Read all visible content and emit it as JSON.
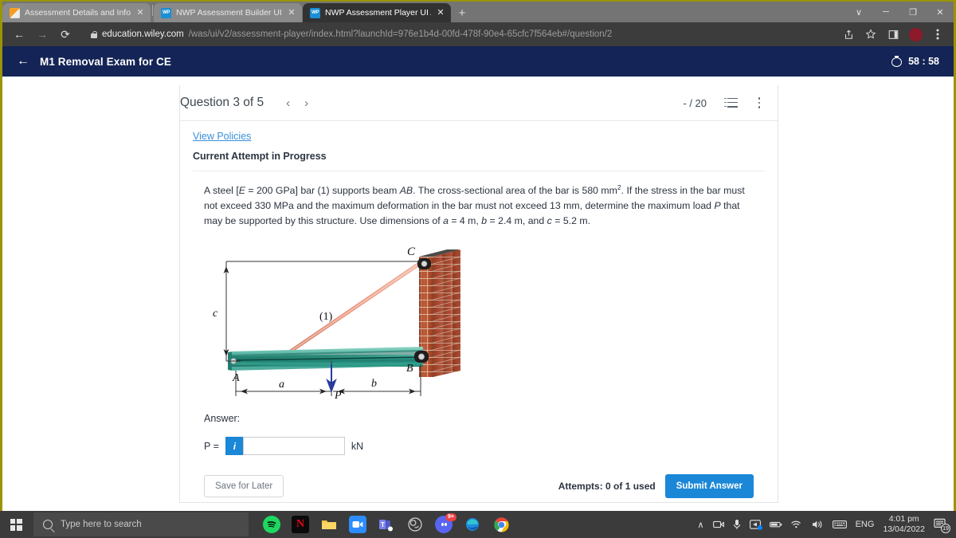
{
  "browser": {
    "tabs": [
      {
        "title": "Assessment Details and Informat",
        "favicon": "pencil-icon",
        "active": false
      },
      {
        "title": "NWP Assessment Builder UI App",
        "favicon": "wp-icon",
        "active": false
      },
      {
        "title": "NWP Assessment Player UI Appli",
        "favicon": "wp-icon",
        "active": true
      }
    ],
    "new_tab_label": "+",
    "close_label": "✕",
    "window_controls": {
      "minimize_all": "∨",
      "minimize": "─",
      "maximize": "❐",
      "close": "✕"
    },
    "nav": {
      "back": "←",
      "forward": "→",
      "reload": "⟳"
    },
    "url_host": "education.wiley.com",
    "url_path": "/was/ui/v2/assessment-player/index.html?launchId=976e1b4d-00fd-478f-90e4-65cfc7f564eb#/question/2",
    "toolbar_icons": [
      "share-icon",
      "bookmark-star-icon",
      "sidepanel-icon",
      "profile-avatar",
      "chrome-menu-icon"
    ]
  },
  "appbar": {
    "back_label": "←",
    "exam_title": "M1 Removal Exam for CE",
    "timer": "58 : 58",
    "timer_icon": "stopwatch-icon"
  },
  "question": {
    "label": "Question 3 of 5",
    "prev": "‹",
    "next": "›",
    "score": "- / 20",
    "list_icon": "numbered-list-icon",
    "menu_icon": "kebab-menu-icon",
    "view_policies": "View Policies",
    "attempt_status": "Current Attempt in Progress",
    "text_line1_a": "A steel [",
    "text_line1_E": "E",
    "text_line1_b": " = 200 GPa] bar (1) supports beam ",
    "text_line1_AB": "AB",
    "text_line1_c": ".  The cross-sectional area of the bar is 580 mm",
    "text_sup": "2",
    "text_line1_d": ".  If the stress in the bar must not exceed 330 MPa and the maximum deformation in the bar must not exceed 13 mm, determine the maximum load ",
    "text_P": "P",
    "text_line1_e": " that may be supported by this structure.  Use dimensions of ",
    "text_a": "a",
    "text_line1_f": " = 4 m, ",
    "text_b": "b",
    "text_line1_g": " = 2.4 m, and ",
    "text_c": "c",
    "text_line1_h": " = 5.2 m."
  },
  "figure": {
    "label_C": "C",
    "label_A": "A",
    "label_B": "B",
    "label_bar": "(1)",
    "label_a": "a",
    "label_b": "b",
    "label_c": "c",
    "label_P": "P",
    "colors": {
      "beam": "#2e9486",
      "bar": "#f0a08a",
      "brick": "#b4502f",
      "arrow": "#2a3a9e"
    }
  },
  "answer": {
    "label": "Answer:",
    "variable": "P =",
    "info_icon": "i",
    "input_value": "",
    "input_placeholder": "",
    "unit": "kN"
  },
  "actions": {
    "save_label": "Save for Later",
    "attempts": "Attempts: 0 of 1 used",
    "submit_label": "Submit Answer"
  },
  "taskbar": {
    "start_icon": "windows-start-icon",
    "search_placeholder": "Type here to search",
    "apps": [
      {
        "name": "spotify-icon",
        "label": ""
      },
      {
        "name": "netflix-icon",
        "label": "N"
      },
      {
        "name": "file-explorer-icon",
        "label": ""
      },
      {
        "name": "zoom-icon",
        "label": ""
      },
      {
        "name": "microsoft-teams-icon",
        "label": ""
      },
      {
        "name": "obs-studio-icon",
        "label": ""
      },
      {
        "name": "discord-icon",
        "label": "9+"
      },
      {
        "name": "microsoft-edge-icon",
        "label": ""
      },
      {
        "name": "google-chrome-icon",
        "label": ""
      }
    ],
    "tray": {
      "chevron": "∧",
      "icons": [
        "camera-icon",
        "microphone-icon",
        "display-icon",
        "battery-icon",
        "wifi-icon",
        "volume-icon",
        "keyboard-icon"
      ],
      "language": "ENG",
      "time": "4:01 pm",
      "date": "13/04/2022",
      "notification_count": "19"
    }
  }
}
